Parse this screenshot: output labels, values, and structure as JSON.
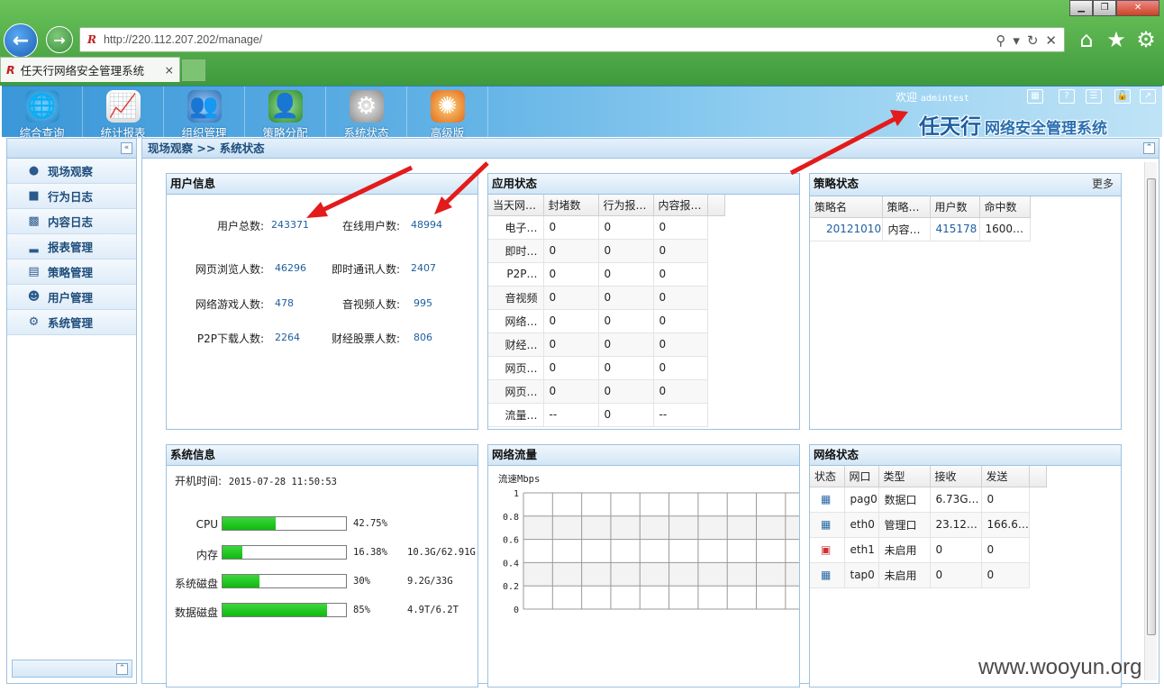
{
  "browser": {
    "url": "http://220.112.207.202/manage/",
    "tab_title": "任天行网络安全管理系统",
    "tab_close": "×",
    "win_min": "▁",
    "win_max": "❐",
    "win_close": "✕"
  },
  "header": {
    "modules": [
      "综合查询",
      "统计报表",
      "组织管理",
      "策略分配",
      "系统状态",
      "高级版"
    ],
    "welcome_label": "欢迎",
    "username": "admintest",
    "brand_main": "任天行",
    "brand_sub": "网络安全管理系统"
  },
  "sidebar": {
    "items": [
      "现场观察",
      "行为日志",
      "内容日志",
      "报表管理",
      "策略管理",
      "用户管理",
      "系统管理"
    ]
  },
  "breadcrumb": "现场观察 >> 系统状态",
  "user_info": {
    "title": "用户信息",
    "rows": [
      {
        "l1": "用户总数:",
        "v1": "243371",
        "l2": "在线用户数:",
        "v2": "48994"
      },
      {
        "l1": "网页浏览人数:",
        "v1": "46296",
        "l2": "即时通讯人数:",
        "v2": "2407"
      },
      {
        "l1": "网络游戏人数:",
        "v1": "478",
        "l2": "音视频人数:",
        "v2": "995"
      },
      {
        "l1": "P2P下载人数:",
        "v1": "2264",
        "l2": "财经股票人数:",
        "v2": "806"
      }
    ]
  },
  "app_status": {
    "title": "应用状态",
    "headers": [
      "当天网…",
      "封堵数",
      "行为报…",
      "内容报…"
    ],
    "rows": [
      [
        "电子…",
        "0",
        "0",
        "0"
      ],
      [
        "即时…",
        "0",
        "0",
        "0"
      ],
      [
        "P2P…",
        "0",
        "0",
        "0"
      ],
      [
        "音视频",
        "0",
        "0",
        "0"
      ],
      [
        "网络…",
        "0",
        "0",
        "0"
      ],
      [
        "财经…",
        "0",
        "0",
        "0"
      ],
      [
        "网页…",
        "0",
        "0",
        "0"
      ],
      [
        "网页…",
        "0",
        "0",
        "0"
      ],
      [
        "流量…",
        "--",
        "0",
        "--"
      ]
    ]
  },
  "policy_status": {
    "title": "策略状态",
    "more": "更多",
    "headers": [
      "策略名",
      "策略…",
      "用户数",
      "命中数"
    ],
    "rows": [
      [
        "20121010",
        "内容…",
        "415178",
        "1600…"
      ]
    ]
  },
  "system_info": {
    "title": "系统信息",
    "boot_label": "开机时间:",
    "boot_time": "2015-07-28 11:50:53",
    "resources": [
      {
        "label": "CPU",
        "percent": 42.75,
        "percent_text": "42.75%",
        "detail": ""
      },
      {
        "label": "内存",
        "percent": 16.38,
        "percent_text": "16.38%",
        "detail": "10.3G/62.91G"
      },
      {
        "label": "系统磁盘",
        "percent": 30,
        "percent_text": "30%",
        "detail": "9.2G/33G"
      },
      {
        "label": "数据磁盘",
        "percent": 85,
        "percent_text": "85%",
        "detail": "4.9T/6.2T"
      }
    ]
  },
  "network_traffic": {
    "title": "网络流量",
    "chart_data": {
      "type": "line",
      "ylabel": "流速Mbps",
      "ylim": [
        0,
        1
      ],
      "yticks": [
        "1",
        "0.8",
        "0.6",
        "0.4",
        "0.2",
        "0"
      ],
      "series": [],
      "grid": true
    }
  },
  "network_status": {
    "title": "网络状态",
    "headers": [
      "状态",
      "网口",
      "类型",
      "接收",
      "发送"
    ],
    "rows": [
      {
        "state": "ok",
        "name": "pag0",
        "type": "数据口",
        "rx": "6.73G…",
        "tx": "0"
      },
      {
        "state": "ok",
        "name": "eth0",
        "type": "管理口",
        "rx": "23.12…",
        "tx": "166.6…"
      },
      {
        "state": "err",
        "name": "eth1",
        "type": "未启用",
        "rx": "0",
        "tx": "0"
      },
      {
        "state": "ok",
        "name": "tap0",
        "type": "未启用",
        "rx": "0",
        "tx": "0"
      }
    ]
  },
  "watermark": "www.wooyun.org",
  "colors": {
    "accent": "#1f5fa0",
    "header": "#3b97d8",
    "progress": "#11bb11",
    "annotation": "#e31b1b"
  }
}
